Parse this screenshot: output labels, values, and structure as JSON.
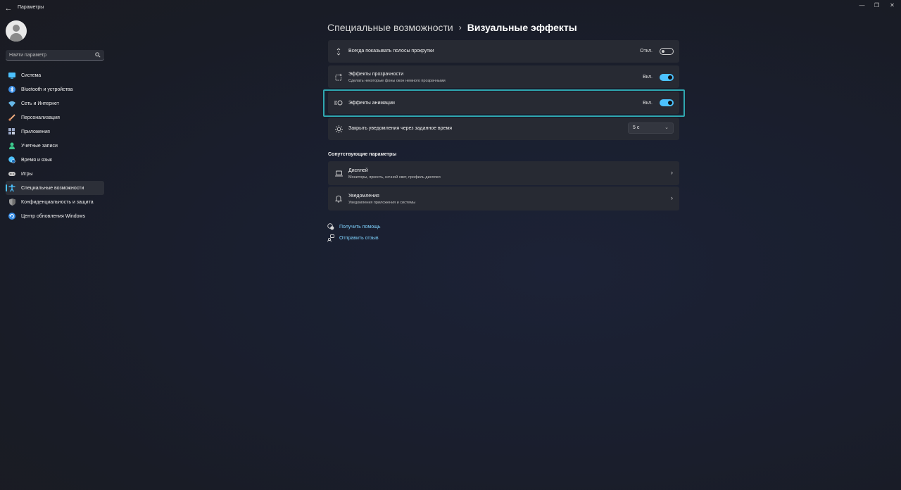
{
  "window": {
    "title": "Параметры",
    "back_icon": "back-arrow-icon",
    "controls": [
      "minimize-icon",
      "maximize-icon",
      "close-icon"
    ]
  },
  "sidebar": {
    "search_placeholder": "Найти параметр",
    "items": [
      {
        "label": "Система",
        "icon": "monitor-icon",
        "color": "#4cc2ff"
      },
      {
        "label": "Bluetooth и устройства",
        "icon": "bluetooth-icon",
        "color": "#3a8ee6"
      },
      {
        "label": "Сеть и Интернет",
        "icon": "wifi-icon",
        "color": "#66b8e8"
      },
      {
        "label": "Персонализация",
        "icon": "brush-icon",
        "color": "#e8a87c"
      },
      {
        "label": "Приложения",
        "icon": "apps-icon",
        "color": "#9aa8c8"
      },
      {
        "label": "Учетные записи",
        "icon": "person-icon",
        "color": "#3cc88c"
      },
      {
        "label": "Время и язык",
        "icon": "globe-clock-icon",
        "color": "#4cc2ff"
      },
      {
        "label": "Игры",
        "icon": "gamepad-icon",
        "color": "#c8c8c8"
      },
      {
        "label": "Специальные возможности",
        "icon": "accessibility-icon",
        "color": "#4cc2ff",
        "active": true
      },
      {
        "label": "Конфиденциальность и защита",
        "icon": "shield-icon",
        "color": "#9a9a9a"
      },
      {
        "label": "Центр обновления Windows",
        "icon": "update-icon",
        "color": "#3a8ee6"
      }
    ]
  },
  "breadcrumb": {
    "parent": "Специальные возможности",
    "separator": "›",
    "current": "Визуальные эффекты"
  },
  "settings": {
    "scrollbars": {
      "title": "Всегда показывать полосы прокрутки",
      "state_label": "Откл.",
      "on": false,
      "icon": "scrollbar-arrows-icon"
    },
    "transparency": {
      "title": "Эффекты прозрачности",
      "subtitle": "Сделать некоторые фоны окон немного прозрачными",
      "state_label": "Вкл.",
      "on": true,
      "icon": "transparency-icon"
    },
    "animation": {
      "title": "Эффекты анимации",
      "state_label": "Вкл.",
      "on": true,
      "icon": "animation-icon"
    },
    "notifications_timeout": {
      "title": "Закрыть уведомления через заданное время",
      "value": "5 с",
      "icon": "sun-icon"
    }
  },
  "related": {
    "title": "Сопутствующие параметры",
    "items": [
      {
        "title": "Дисплей",
        "subtitle": "Мониторы, яркость, ночной свет, профиль дисплея",
        "icon": "laptop-icon"
      },
      {
        "title": "Уведомления",
        "subtitle": "Уведомления приложения и системы",
        "icon": "bell-icon"
      }
    ]
  },
  "links": {
    "help": {
      "label": "Получить помощь",
      "icon": "help-chat-icon"
    },
    "feedback": {
      "label": "Отправить отзыв",
      "icon": "feedback-icon"
    }
  },
  "colors": {
    "accent": "#4cc2ff",
    "highlight_box": "#2fa7b0",
    "card_bg": "#272a33"
  }
}
